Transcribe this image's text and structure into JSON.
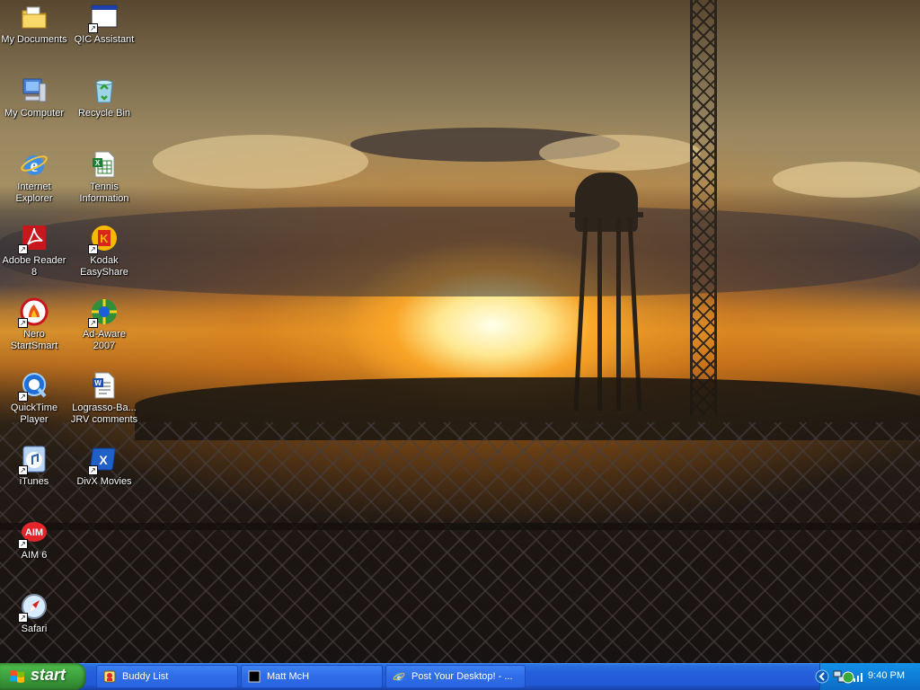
{
  "desktop": {
    "icons": [
      {
        "label": "My Documents",
        "icon": "folder-icon"
      },
      {
        "label": "QIC Assistant",
        "icon": "window-icon"
      },
      {
        "label": "My Computer",
        "icon": "computer-icon"
      },
      {
        "label": "Recycle Bin",
        "icon": "recycle-bin-icon"
      },
      {
        "label": "Internet\nExplorer",
        "icon": "internet-explorer-icon"
      },
      {
        "label": "Tennis\nInformation",
        "icon": "excel-file-icon"
      },
      {
        "label": "Adobe Reader\n8",
        "icon": "adobe-reader-icon"
      },
      {
        "label": "Kodak\nEasyShare",
        "icon": "kodak-icon"
      },
      {
        "label": "Nero\nStartSmart",
        "icon": "nero-icon"
      },
      {
        "label": "Ad-Aware\n2007",
        "icon": "ad-aware-icon"
      },
      {
        "label": "QuickTime\nPlayer",
        "icon": "quicktime-icon"
      },
      {
        "label": "Lograsso-Ba...\nJRV comments",
        "icon": "word-file-icon"
      },
      {
        "label": "iTunes",
        "icon": "itunes-icon"
      },
      {
        "label": "DivX Movies",
        "icon": "divx-icon"
      },
      {
        "label": "AIM 6",
        "icon": "aim-icon"
      },
      {
        "label": "Safari",
        "icon": "safari-icon"
      }
    ]
  },
  "taskbar": {
    "start_label": "start",
    "tasks": [
      {
        "label": "Buddy List",
        "icon": "aim-buddy-icon"
      },
      {
        "label": "Matt McH",
        "icon": "chat-window-icon"
      },
      {
        "label": "Post Your Desktop! - ...",
        "icon": "internet-explorer-icon"
      }
    ],
    "clock": "9:40 PM"
  },
  "colors": {
    "taskbar_blue": "#245edb",
    "start_green": "#3a9a3a",
    "tray_blue": "#0f7fd8"
  }
}
